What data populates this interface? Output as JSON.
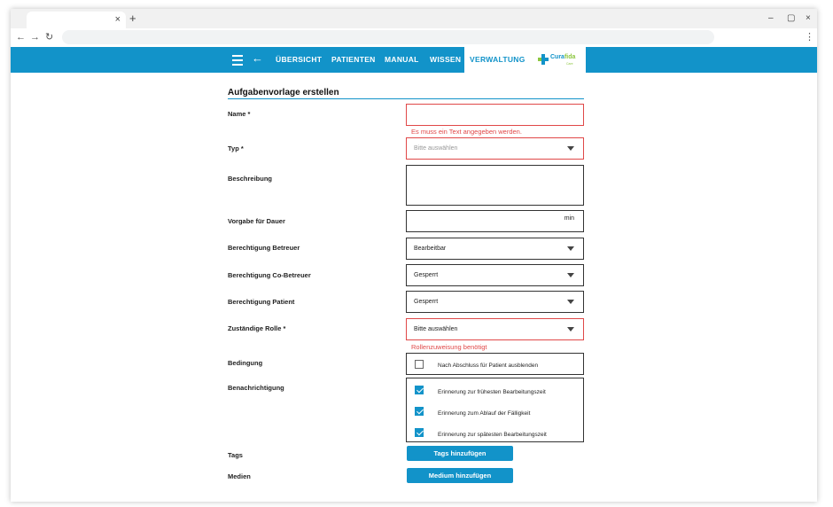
{
  "browser": {
    "tab_close": "×",
    "new_tab": "+",
    "minimize": "–",
    "restore": "▢",
    "close": "×",
    "back": "←",
    "forward": "→",
    "reload": "↻",
    "menu": "⋮"
  },
  "nav": {
    "back_arrow": "←",
    "items": [
      {
        "label": "ÜBERSICHT"
      },
      {
        "label": "PATIENTEN"
      },
      {
        "label": "MANUAL"
      },
      {
        "label": "WISSEN"
      },
      {
        "label": "VERWALTUNG",
        "active": true
      }
    ],
    "logo": {
      "part1": "Cura",
      "part2": "fida",
      "sub": "Care"
    },
    "accent_color": "#1293c9",
    "logo_green": "#8cc63f"
  },
  "form": {
    "title": "Aufgabenvorlage erstellen",
    "name": {
      "label": "Name *",
      "value": "",
      "error": "Es muss ein Text angegeben werden."
    },
    "typ": {
      "label": "Typ *",
      "placeholder": "Bitte auswählen"
    },
    "beschreibung": {
      "label": "Beschreibung",
      "value": ""
    },
    "dauer": {
      "label": "Vorgabe für Dauer",
      "unit": "min"
    },
    "berechtigung_betreuer": {
      "label": "Berechtigung Betreuer",
      "value": "Bearbeitbar"
    },
    "berechtigung_co_betreuer": {
      "label": "Berechtigung Co-Betreuer",
      "value": "Gesperrt"
    },
    "berechtigung_patient": {
      "label": "Berechtigung Patient",
      "value": "Gesperrt"
    },
    "rolle": {
      "label": "Zuständige Rolle *",
      "value": "Bitte auswählen",
      "error": "Rollenzuweisung benötigt"
    },
    "bedingung": {
      "label": "Bedingung",
      "option": "Nach Abschluss für Patient ausblenden",
      "checked": false
    },
    "benachrichtigung": {
      "label": "Benachrichtigung",
      "options": [
        {
          "label": "Erinnerung zur frühesten Bearbeitungszeit",
          "checked": true
        },
        {
          "label": "Erinnerung zum Ablauf der Fälligkeit",
          "checked": true
        },
        {
          "label": "Erinnerung zur spätesten Bearbeitungszeit",
          "checked": true
        }
      ]
    },
    "tags": {
      "label": "Tags",
      "button": "Tags hinzufügen"
    },
    "medien": {
      "label": "Medien",
      "button": "Medium hinzufügen"
    },
    "error_color": "#e04848"
  }
}
